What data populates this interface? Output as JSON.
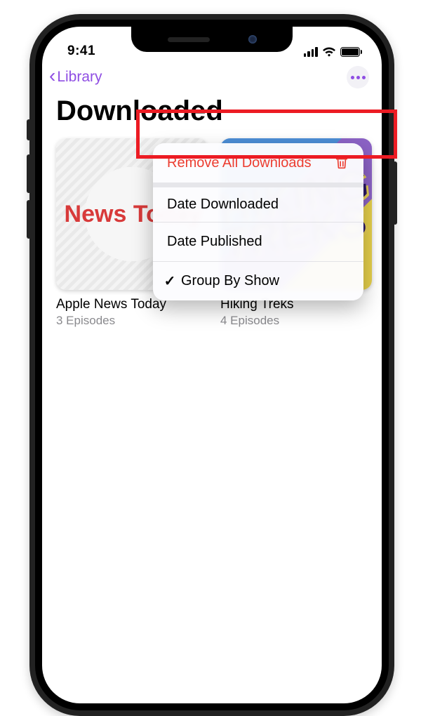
{
  "status": {
    "time": "9:41"
  },
  "nav": {
    "back_label": "Library"
  },
  "page_title": "Downloaded",
  "menu": {
    "remove_all": "Remove All Downloads",
    "date_downloaded": "Date Downloaded",
    "date_published": "Date Published",
    "group_by_show": "Group By Show",
    "group_by_show_checked": true
  },
  "podcasts": [
    {
      "title": "Apple News Today",
      "subtitle": "3 Episodes",
      "art_label_prefix": "News",
      "art_label_accent": "Today"
    },
    {
      "title": "Hiking Treks",
      "subtitle": "4 Episodes",
      "art_text": "HIKING\nTREKS"
    }
  ]
}
